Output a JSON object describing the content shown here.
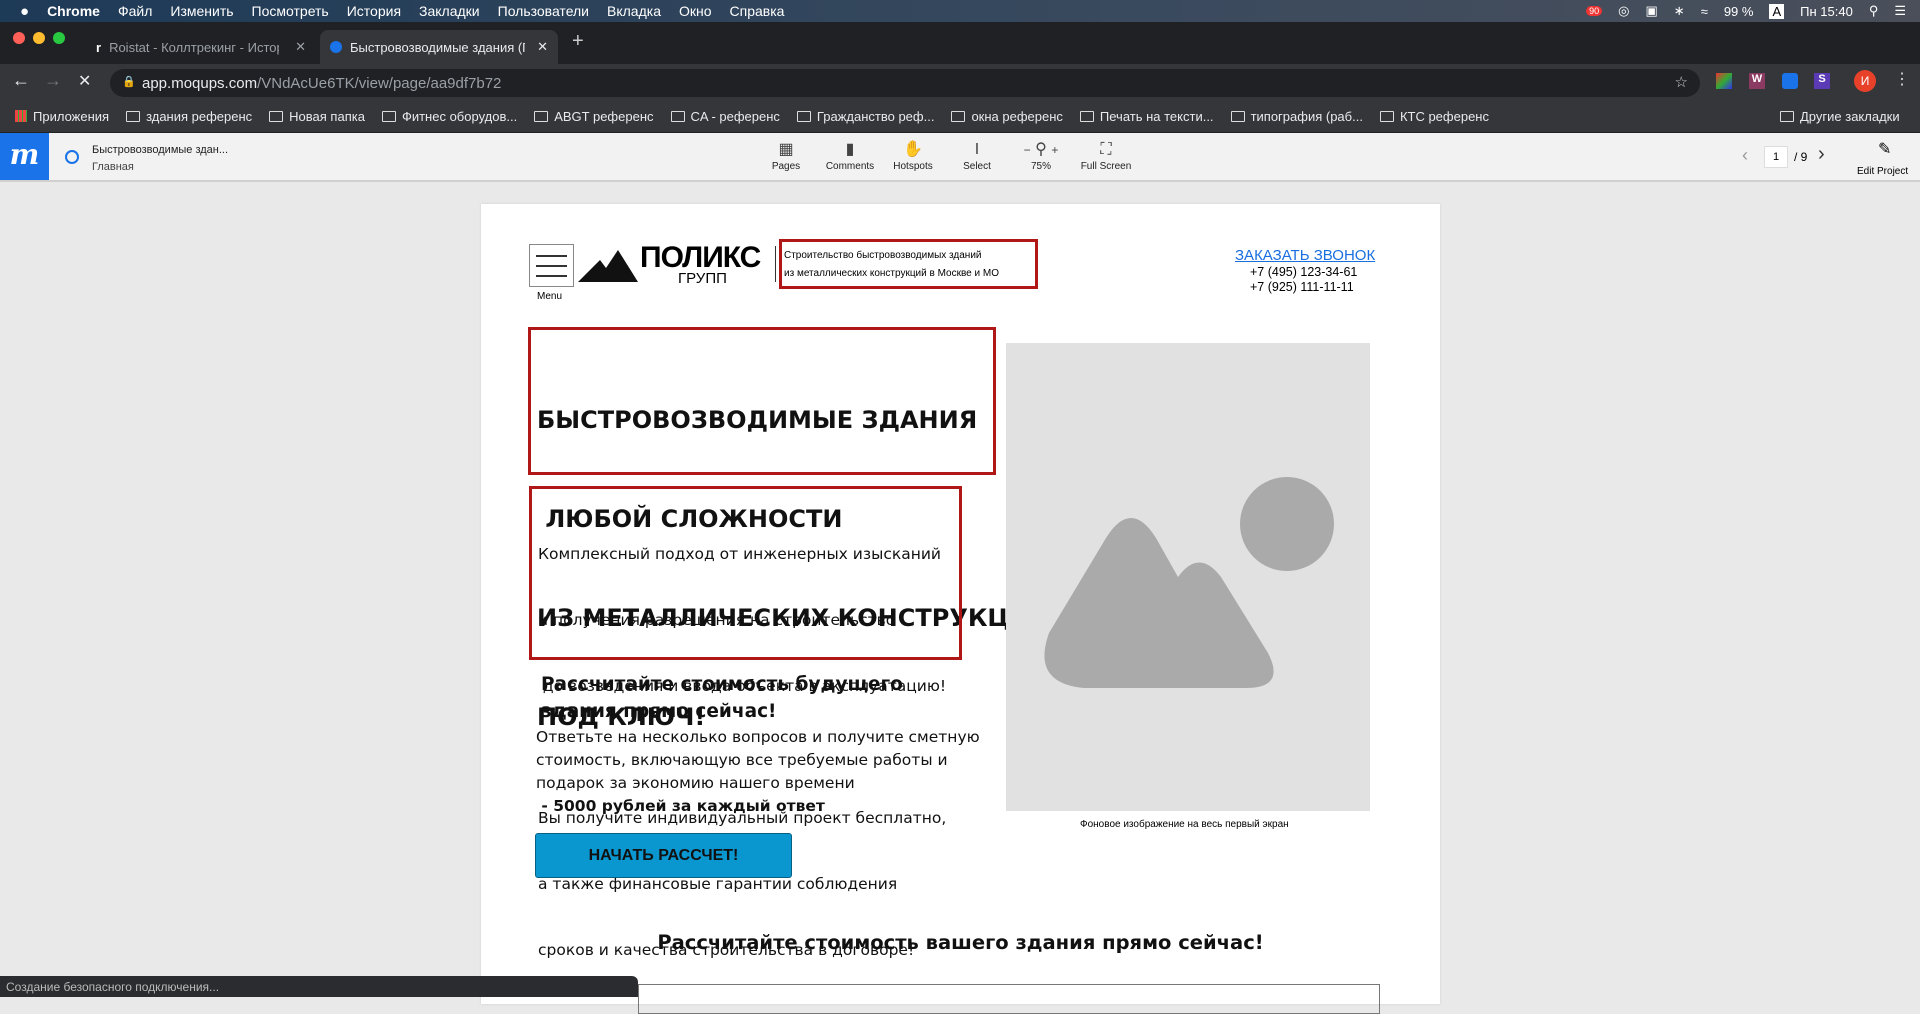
{
  "menubar": {
    "app": "Chrome",
    "items": [
      "Файл",
      "Изменить",
      "Посмотреть",
      "История",
      "Закладки",
      "Пользователи",
      "Вкладка",
      "Окно",
      "Справка"
    ],
    "badge": "90",
    "battery": "99 %",
    "input": "A",
    "clock": "Пн 15:40"
  },
  "tabs": [
    {
      "title": "Roistat - Коллтрекинг - Истор",
      "active": false
    },
    {
      "title": "Быстровозводимые здания (П",
      "active": true
    }
  ],
  "address": {
    "host": "app.moqups.com",
    "path": "/VNdAcUe6TK/view/page/aa9df7b72"
  },
  "extensions": {
    "w": "W",
    "s": "S",
    "avatar": "И"
  },
  "bookmarks": {
    "apps": "Приложения",
    "items": [
      "здания референс",
      "Новая папка",
      "Фитнес оборудов...",
      "ABGT референс",
      "CA - референс",
      "Гражданство реф...",
      "окна референс",
      "Печать на тексти...",
      "типография (раб...",
      "КТС референс"
    ],
    "other": "Другие закладки"
  },
  "moqups": {
    "logo": "m",
    "project": "Быстровозводимые здан...",
    "page": "Главная",
    "tools": [
      "Pages",
      "Comments",
      "Hotspots",
      "Select",
      "75%",
      "Full Screen"
    ],
    "zoom_minus": "−",
    "zoom_plus": "+",
    "page_num": "1",
    "page_total": "/ 9",
    "edit": "Edit Project"
  },
  "site": {
    "menu_label": "Menu",
    "logo_name": "ПОЛИКС",
    "logo_sub": "ГРУПП",
    "tagline": [
      "Строительство быстровозводимых зданий",
      "из металлических конструкций в Москве и МО"
    ],
    "call_link": "ЗАКАЗАТЬ ЗВОНОК",
    "phones": [
      "+7 (495) 123-34-61",
      "+7 (925) 111-11-11"
    ],
    "headline": [
      "БЫСТРОВОЗВОДИМЫЕ ЗДАНИЯ",
      " ЛЮБОЙ СЛОЖНОСТИ",
      "ИЗ МЕТАЛЛИЧЕСКИХ КОНСТРУКЦИЙ",
      "ПОД КЛЮЧ!"
    ],
    "intro": [
      "Комплексный подход от инженерных изысканий",
      "и получения разрешения на строительство",
      " до возведения и ввода объекта в эксплуатацию!",
      "",
      "Вы получите индивидуальный проект бесплатно,",
      "а также финансовые гарантии соблюдения",
      "сроков и качества строительства в договоре!"
    ],
    "calc_heading": [
      "Рассчитайте стоимость будущего",
      "здания прямо сейчас!"
    ],
    "calc_text": [
      "Ответьте на несколько вопросов и получите сметную",
      "стоимость, включающую все требуемые работы и",
      "подарок за экономию нашего времени"
    ],
    "calc_bonus": " - 5000 рублей за каждый ответ",
    "cta": "НАЧАТЬ РАССЧЕТ!",
    "image_caption": "Фоновое изображение на весь первый экран",
    "section2_heading": "Рассчитайте стоимость вашего здания прямо сейчас!"
  },
  "status": "Создание безопасного подключения...",
  "colors": {
    "accent_red": "#b01717",
    "cta": "#0a96cf",
    "link": "#1a6fe0",
    "moqups_blue": "#1a73e8"
  }
}
